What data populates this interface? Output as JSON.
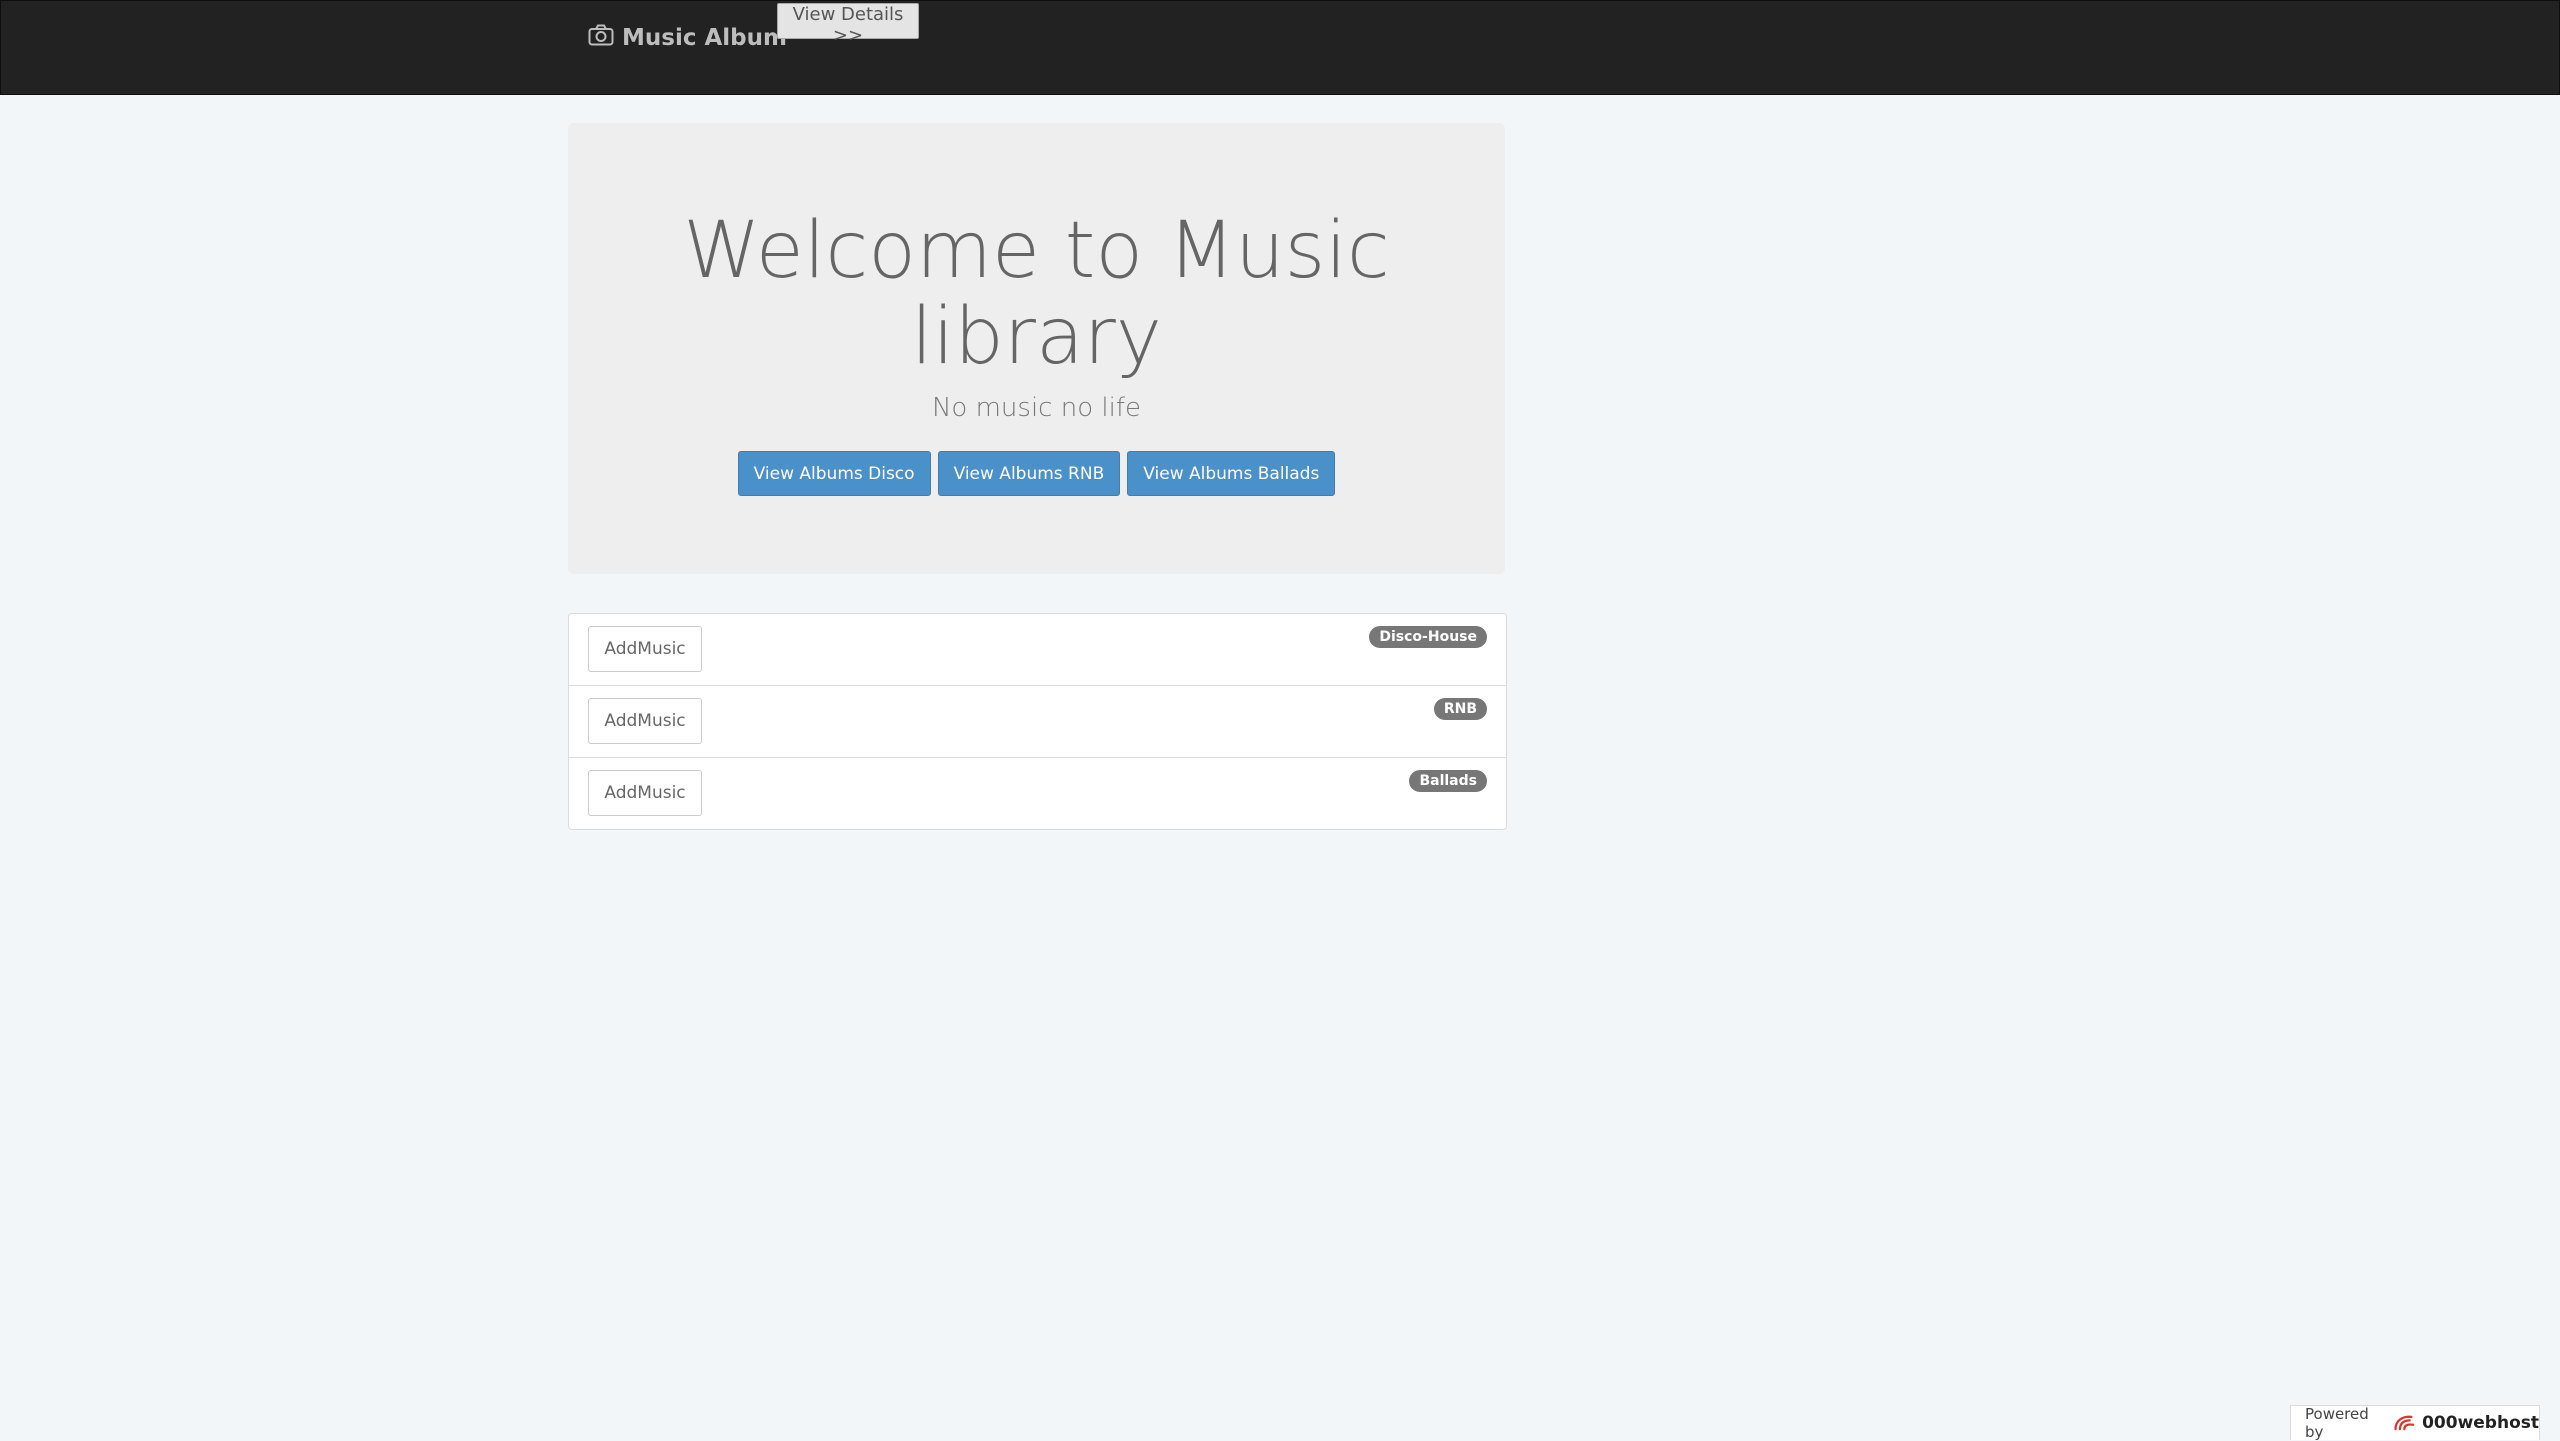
{
  "navbar": {
    "brand_label": "Music Album",
    "brand_icon": "camera-icon",
    "details_button": "View Details >>"
  },
  "jumbotron": {
    "title": "Welcome to Music library",
    "subtitle": "No music no life",
    "buttons": [
      {
        "label": "View Albums Disco"
      },
      {
        "label": "View Albums RNB"
      },
      {
        "label": "View Albums Ballads"
      }
    ]
  },
  "list": {
    "items": [
      {
        "button": "AddMusic",
        "badge": "Disco-House"
      },
      {
        "button": "AddMusic",
        "badge": "RNB"
      },
      {
        "button": "AddMusic",
        "badge": "Ballads"
      }
    ]
  },
  "footer": {
    "powered_by": "Powered by",
    "host_name": "000webhost",
    "logo_icon": "webhost-logo-icon"
  },
  "colors": {
    "navbar_bg": "#222222",
    "primary_button": "#4a90c9",
    "badge_bg": "#777777",
    "page_bg": "#f3f6f9",
    "jumbotron_bg": "#eeeeee"
  }
}
